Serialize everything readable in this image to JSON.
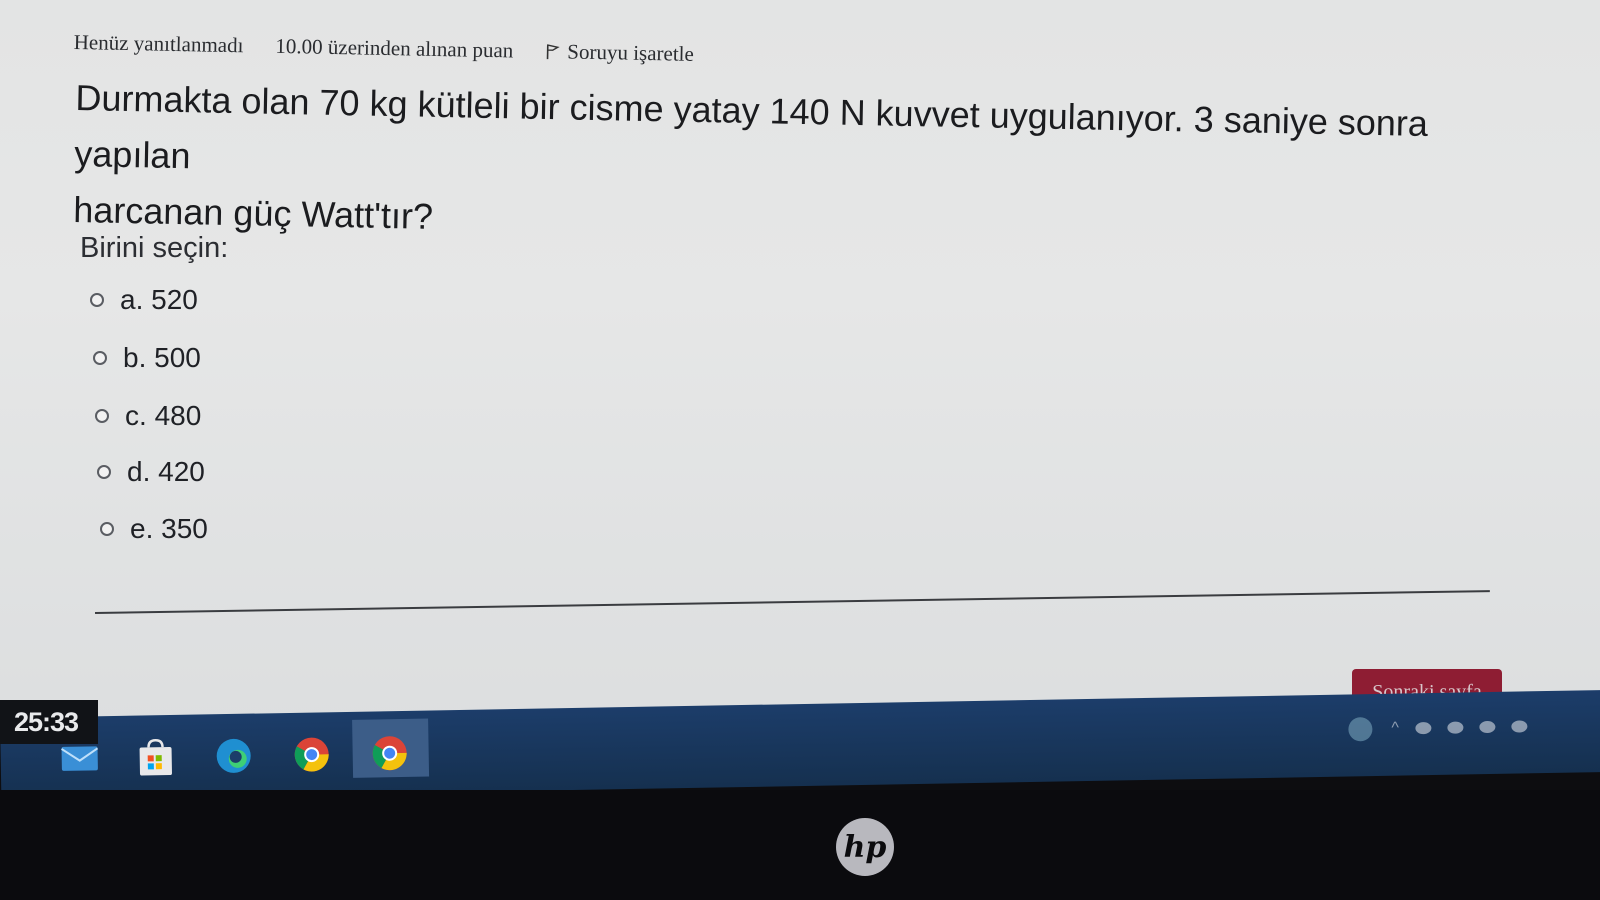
{
  "meta": {
    "status": "Henüz yanıtlanmadı",
    "points": "10.00 üzerinden alınan puan",
    "flag_label": "Soruyu işaretle"
  },
  "question": {
    "line1": "Durmakta olan 70 kg kütleli bir cisme yatay 140 N kuvvet uygulanıyor. 3 saniye sonra yapılan",
    "line2": "harcanan güç Watt'tır?"
  },
  "choose_label": "Birini seçin:",
  "options": [
    {
      "letter": "a.",
      "value": "520"
    },
    {
      "letter": "b.",
      "value": "500"
    },
    {
      "letter": "c.",
      "value": "480"
    },
    {
      "letter": "d.",
      "value": "420"
    },
    {
      "letter": "e.",
      "value": "350"
    }
  ],
  "next_button": "Sonraki sayfa",
  "timer": "25:33",
  "taskbar_icons": [
    "mail-icon",
    "store-icon",
    "edge-icon",
    "chrome-icon",
    "chrome-active-icon"
  ],
  "colors": {
    "next_button_bg": "#8e1d33",
    "taskbar_bg": "#1c3d6a"
  },
  "brand": "hp"
}
